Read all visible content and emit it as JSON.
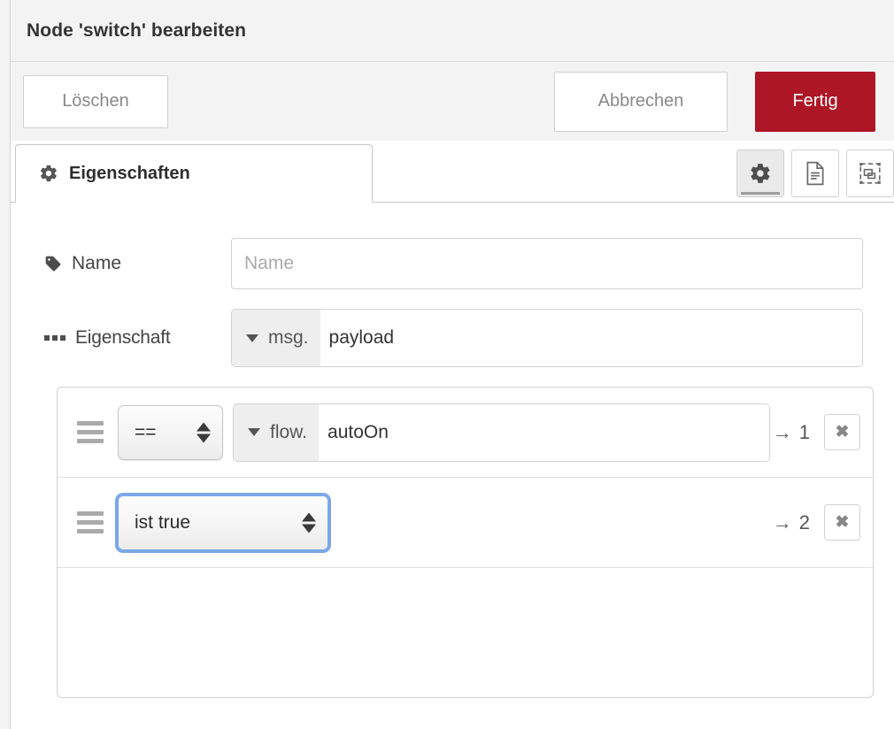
{
  "dialog": {
    "title": "Node 'switch' bearbeiten"
  },
  "actions": {
    "delete_label": "Löschen",
    "cancel_label": "Abbrechen",
    "done_label": "Fertig",
    "primary_color": "#ad1625"
  },
  "tabs": [
    {
      "label": "Eigenschaften",
      "icon": "gear-icon",
      "active": true
    }
  ],
  "tab_icon_buttons": [
    {
      "name": "properties-icon",
      "active": true
    },
    {
      "name": "description-icon",
      "active": false
    },
    {
      "name": "appearance-icon",
      "active": false
    }
  ],
  "form": {
    "name_row": {
      "label": "Name",
      "icon": "tag-icon",
      "value": "",
      "placeholder": "Name"
    },
    "property_row": {
      "label": "Eigenschaft",
      "icon": "ellipsis-icon",
      "prefix": "msg.",
      "value": "payload"
    }
  },
  "rules": [
    {
      "operator": "==",
      "operator_focused": false,
      "has_value_input": true,
      "value_prefix": "flow.",
      "value": "autoOn",
      "output_arrow": "→",
      "output": "1",
      "delete_glyph": "✖"
    },
    {
      "operator": "ist true",
      "operator_focused": true,
      "has_value_input": false,
      "value_prefix": "",
      "value": "",
      "output_arrow": "→",
      "output": "2",
      "delete_glyph": "✖"
    }
  ]
}
